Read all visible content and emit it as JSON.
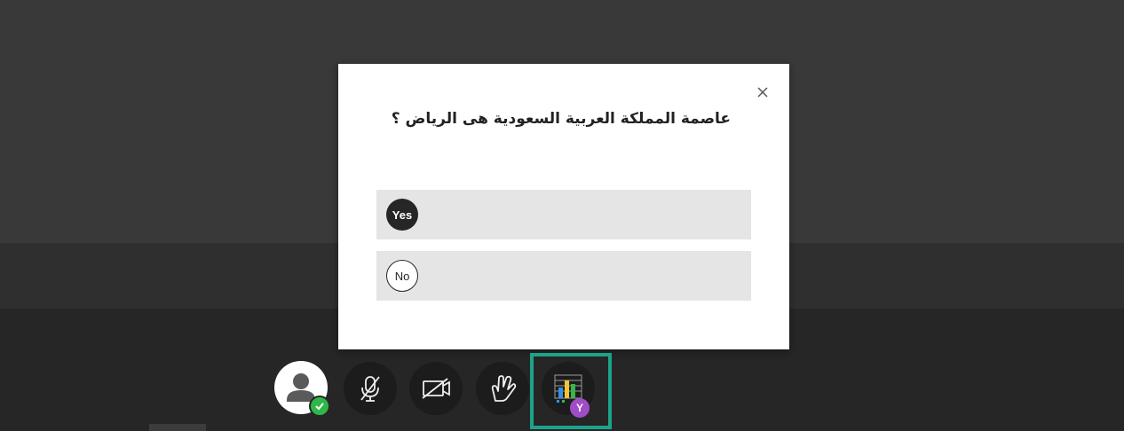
{
  "poll_dialog": {
    "question": "عاصمة المملكة العربية السعودية هى الرياض ؟",
    "answers": [
      {
        "label": "Yes",
        "selected": true
      },
      {
        "label": "No",
        "selected": false
      }
    ],
    "close_icon": "close-icon"
  },
  "toolbar": {
    "buttons": [
      {
        "icon": "user-avatar-icon",
        "status_icon": "checkmark-icon"
      },
      {
        "icon": "microphone-off-icon"
      },
      {
        "icon": "camera-off-icon"
      },
      {
        "icon": "raise-hand-icon"
      },
      {
        "icon": "poll-chart-icon",
        "badge": "Y",
        "highlighted": true
      }
    ]
  },
  "colors": {
    "dialog_bg": "#ffffff",
    "answer_bg": "#e5e5e5",
    "highlight_border": "#1ca38a",
    "status_green": "#2fb84a",
    "badge_purple": "#a04cc6",
    "button_bg": "#1c1c1c"
  }
}
